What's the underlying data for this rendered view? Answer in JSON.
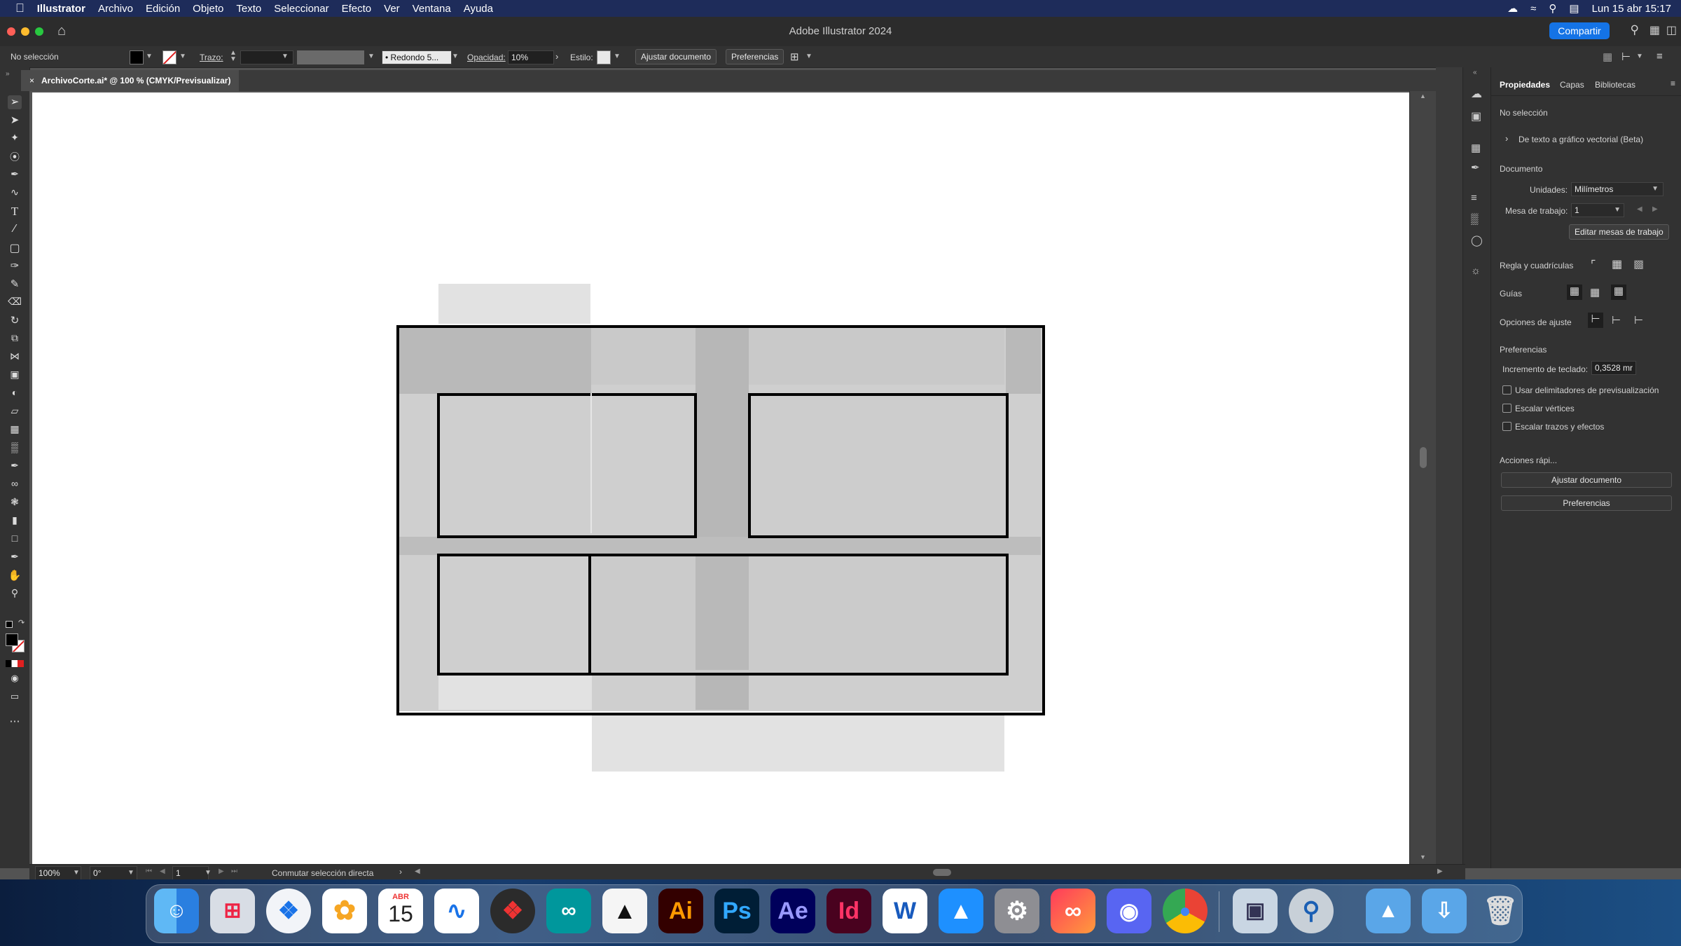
{
  "menubar": {
    "app_name": "Illustrator",
    "items": [
      "Archivo",
      "Edición",
      "Objeto",
      "Texto",
      "Seleccionar",
      "Efecto",
      "Ver",
      "Ventana",
      "Ayuda"
    ],
    "datetime": "Lun 15 abr 15:17"
  },
  "window": {
    "title": "Adobe Illustrator 2024",
    "share_label": "Compartir"
  },
  "control_bar": {
    "selection_status": "No selección",
    "stroke_label": "Trazo:",
    "brush_value": "Redondo 5...",
    "opacity_label": "Opacidad:",
    "opacity_value": "10%",
    "style_label": "Estilo:",
    "fit_doc_label": "Ajustar documento",
    "preferences_label": "Preferencias"
  },
  "document_tab": {
    "label": "ArchivoCorte.ai* @ 100 % (CMYK/Previsualizar)"
  },
  "properties_panel": {
    "tabs": [
      "Propiedades",
      "Capas",
      "Bibliotecas"
    ],
    "no_selection": "No selección",
    "text_to_vector": "De texto a gráfico vectorial (Beta)",
    "document_heading": "Documento",
    "units_label": "Unidades:",
    "units_value": "Milímetros",
    "artboard_label": "Mesa de trabajo:",
    "artboard_value": "1",
    "edit_artboards": "Editar mesas de trabajo",
    "rulers_grids_label": "Regla y cuadrículas",
    "guides_label": "Guías",
    "snap_options_label": "Opciones de ajuste",
    "preferences_heading": "Preferencias",
    "keyboard_increment_label": "Incremento de teclado:",
    "keyboard_increment_value": "0,3528 mr",
    "checkboxes": [
      "Usar delimitadores de previsualización",
      "Escalar vértices",
      "Escalar trazos y efectos"
    ],
    "quick_actions_heading": "Acciones rápi...",
    "fit_doc_button": "Ajustar documento",
    "preferences_button": "Preferencias"
  },
  "status_bar": {
    "zoom": "100%",
    "rotation": "0°",
    "artboard_number": "1",
    "tool_hint": "Conmutar selección directa"
  },
  "dock": {
    "calendar_month": "ABR",
    "calendar_day": "15",
    "icons": [
      "finder-icon",
      "launchpad-icon",
      "safari-icon",
      "photos-icon",
      "calendar-icon",
      "freeform-icon",
      "instruments-icon",
      "arduino-icon",
      "inkscape-icon",
      "illustrator-icon",
      "photoshop-icon",
      "after-effects-icon",
      "indesign-icon",
      "word-icon",
      "app-store-icon",
      "system-settings-icon",
      "creative-cloud-icon",
      "discord-icon",
      "chrome-icon",
      "preview-icon",
      "quicktime-icon",
      "applications-folder-icon",
      "downloads-folder-icon",
      "trash-icon"
    ],
    "labels": {
      "illustrator": "Ai",
      "photoshop": "Ps",
      "after_effects": "Ae",
      "indesign": "Id",
      "word": "W"
    }
  },
  "colors": {
    "menubar": "#1e2c5a",
    "accent": "#1473e6",
    "panel_bg": "#323232",
    "artboard": "#ffffff"
  }
}
